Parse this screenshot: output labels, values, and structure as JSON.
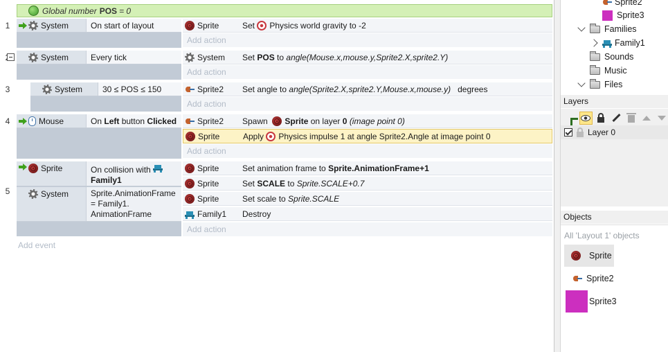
{
  "global_var": {
    "prefix": "Global number",
    "name": "POS",
    "value": "= 0"
  },
  "events": [
    {
      "num": "1",
      "conditions": [
        {
          "object": "System",
          "text": "On start of layout"
        }
      ],
      "actions": [
        {
          "object": "Sprite",
          "pre": "Set",
          "post": "Physics world gravity to -2"
        }
      ]
    },
    {
      "num": "2",
      "conditions": [
        {
          "object": "System",
          "text": "Every tick"
        }
      ],
      "actions": [
        {
          "object": "System",
          "pre": "Set",
          "bold": "POS",
          "mid": "to",
          "italic": "angle(Mouse.x,mouse.y,Sprite2.X,sprite2.Y)"
        }
      ]
    },
    {
      "num": "3",
      "conditions": [
        {
          "object": "System",
          "text": "30 ≤ POS ≤ 150"
        }
      ],
      "actions": [
        {
          "object": "Sprite2",
          "pre": "Set angle to",
          "italic": "angle(Sprite2.X,sprite2.Y,Mouse.x,mouse.y)",
          "post": "degrees"
        }
      ]
    },
    {
      "num": "4",
      "conditions": [
        {
          "object": "Mouse",
          "pre": "On",
          "bold1": "Left",
          "mid": "button",
          "bold2": "Clicked"
        }
      ],
      "actions": [
        {
          "object": "Sprite2",
          "pre": "Spawn",
          "bold": "Sprite",
          "mid": "on layer",
          "bold2": "0",
          "italic": "(image point 0)"
        },
        {
          "object": "Sprite",
          "pre": "Apply",
          "post": "Physics impulse 1 at angle Sprite2.Angle at image point 0"
        }
      ]
    },
    {
      "num": "5",
      "conditions": [
        {
          "object": "Sprite",
          "text": "On collision with",
          "bold": "Family1"
        },
        {
          "object": "System",
          "line1": "Sprite.AnimationFrame",
          "line2": "= Family1.",
          "line3": "AnimationFrame"
        }
      ],
      "actions": [
        {
          "object": "Sprite",
          "pre": "Set animation frame to",
          "bold": "Sprite.AnimationFrame+1"
        },
        {
          "object": "Sprite",
          "pre": "Set",
          "bold": "SCALE",
          "mid": "to",
          "italic": "Sprite.SCALE+0.7"
        },
        {
          "object": "Sprite",
          "pre": "Set scale to",
          "italic": "Sprite.SCALE"
        },
        {
          "object": "Family1",
          "pre": "Destroy"
        }
      ]
    }
  ],
  "add_action": "Add action",
  "add_event": "Add event",
  "project_tree": {
    "sprite2_partial": "Sprite2",
    "sprite3": "Sprite3",
    "families": "Families",
    "family1": "Family1",
    "sounds": "Sounds",
    "music": "Music",
    "files": "Files"
  },
  "layers": {
    "header": "Layers",
    "layer0": "Layer 0"
  },
  "objects": {
    "header": "Objects",
    "filter": "All 'Layout 1' objects",
    "items": [
      "Sprite",
      "Sprite2",
      "Sprite3"
    ]
  },
  "colors": {
    "sprite3": "#cc2fbf",
    "global_var_bg": "#d4f0b6",
    "selected_action": "#fdf3c6"
  }
}
